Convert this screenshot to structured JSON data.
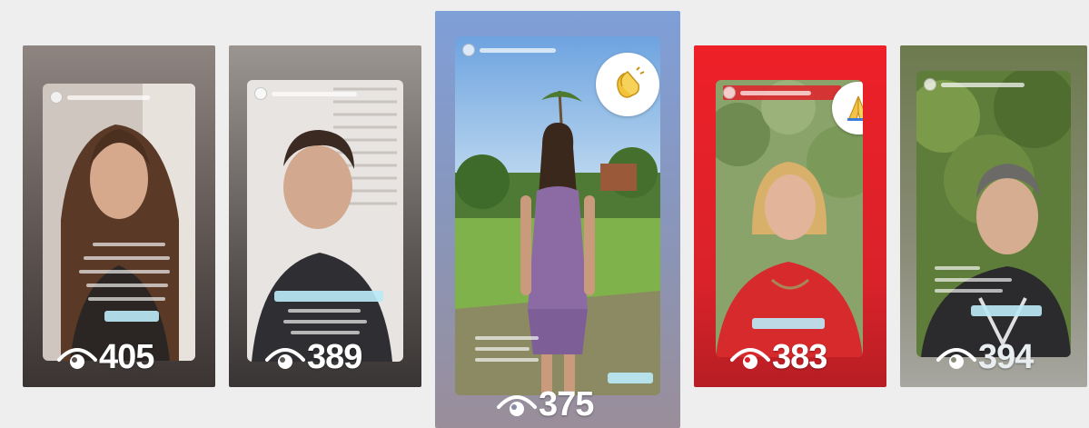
{
  "stories": [
    {
      "id": "story-1",
      "views": "405",
      "frame_color": "#7c6f6a",
      "sticker": null
    },
    {
      "id": "story-2",
      "views": "389",
      "frame_color": "#6e6a68",
      "sticker": null
    },
    {
      "id": "story-3",
      "views": "375",
      "frame_color": "#8aa6d8",
      "sticker": "clapping-hands-icon"
    },
    {
      "id": "story-4",
      "views": "383",
      "frame_color": "#e0262e",
      "sticker": "praying-hands-icon"
    },
    {
      "id": "story-5",
      "views": "394",
      "frame_color": "#7a7d63",
      "sticker": null
    }
  ]
}
